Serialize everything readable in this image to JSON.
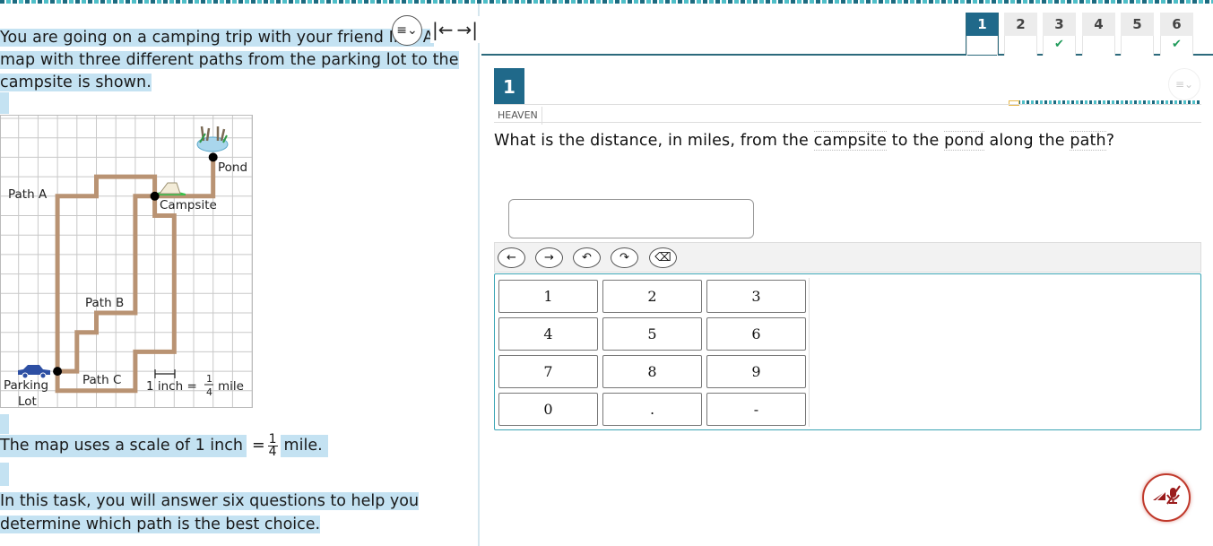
{
  "left": {
    "intro_lines": [
      "You are going on a camping trip with your friend Iris. A",
      "map with three different paths from the parking lot to the",
      "campsite is shown."
    ],
    "map": {
      "labels": {
        "path_a": "Path A",
        "path_b": "Path B",
        "path_c": "Path C",
        "pond": "Pond",
        "campsite": "Campsite",
        "parking_line1": "Parking",
        "parking_line2": "Lot",
        "scale_prefix": "1 inch =",
        "scale_num": "1",
        "scale_den": "4",
        "scale_suffix": "mile"
      },
      "grid_cols": 13,
      "grid_rows": 15,
      "path_color": "#b99373",
      "paths": {
        "a": [
          [
            3,
            13
          ],
          [
            3,
            4
          ],
          [
            5,
            4
          ],
          [
            5,
            3
          ],
          [
            8,
            3
          ],
          [
            8,
            4
          ]
        ],
        "b": [
          [
            3,
            13
          ],
          [
            4,
            13
          ],
          [
            4,
            11
          ],
          [
            5,
            11
          ],
          [
            5,
            10
          ],
          [
            7,
            10
          ],
          [
            7,
            4
          ],
          [
            8,
            4
          ]
        ],
        "c": [
          [
            3,
            13
          ],
          [
            3,
            14
          ],
          [
            7,
            14
          ],
          [
            7,
            12
          ],
          [
            9,
            12
          ],
          [
            9,
            5
          ],
          [
            8,
            5
          ],
          [
            8,
            4
          ]
        ],
        "pond": [
          [
            8,
            4
          ],
          [
            11,
            4
          ],
          [
            11,
            2
          ]
        ]
      },
      "points": {
        "parking": [
          3,
          13
        ],
        "campsite": [
          8,
          4
        ],
        "pond": [
          11,
          2
        ]
      }
    },
    "scale_sentence": {
      "prefix": "The map uses a scale of 1 inch",
      "equals": "=",
      "num": "1",
      "den": "4",
      "suffix": "mile."
    },
    "task_lines": [
      "In this task, you will answer six questions to help you",
      "determine which path is the best choice."
    ],
    "controls": {
      "menu_icon": "≡⌄",
      "collapse_left": "|←",
      "expand_right": "→|"
    }
  },
  "right": {
    "question_tabs": [
      {
        "label": "1",
        "active": true,
        "status": ""
      },
      {
        "label": "2",
        "active": false,
        "status": ""
      },
      {
        "label": "3",
        "active": false,
        "status": "✔"
      },
      {
        "label": "4",
        "active": false,
        "status": ""
      },
      {
        "label": "5",
        "active": false,
        "status": ""
      },
      {
        "label": "6",
        "active": false,
        "status": "✔"
      }
    ],
    "question_number": "1",
    "meta_label": "HEAVEN",
    "question": {
      "part1": "What is the distance, in miles, from the ",
      "term1": "campsite",
      "part2": " to the ",
      "term2": "pond",
      "part3": " along the ",
      "term3": "path",
      "part4": "?"
    },
    "answer_value": "",
    "toolbar": {
      "left": "←",
      "right": "→",
      "undo": "↶",
      "redo": "↷",
      "backspace": "⌫"
    },
    "keypad": [
      "1",
      "2",
      "3",
      "4",
      "5",
      "6",
      "7",
      "8",
      "9",
      "0",
      ".",
      "-"
    ],
    "colors": {
      "accent": "#20698a",
      "check": "#1f9a5a",
      "mute": "#c0392b"
    }
  }
}
